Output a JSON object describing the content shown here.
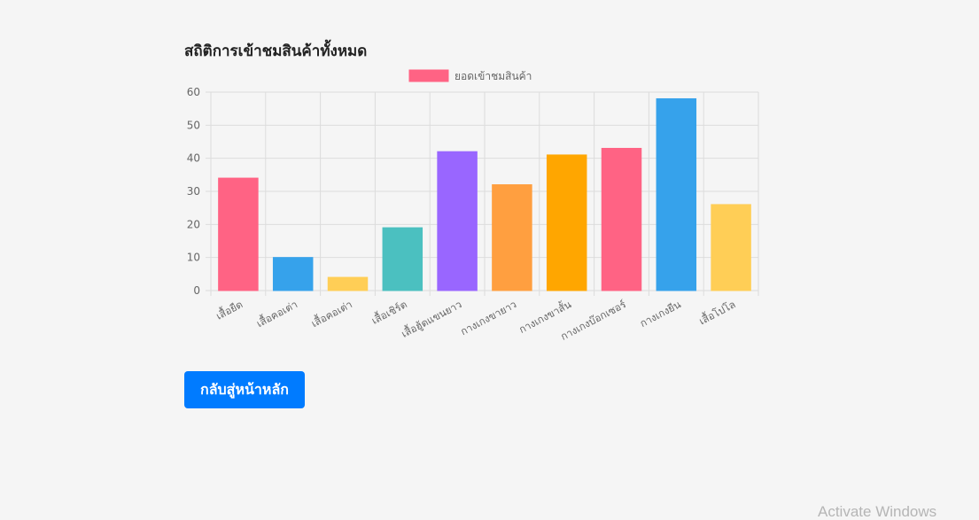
{
  "page": {
    "title": "สถิติการเข้าชมสินค้าทั้งหมด",
    "back_button": "กลับสู่หน้าหลัก",
    "watermark": "Activate Windows"
  },
  "chart_data": {
    "type": "bar",
    "categories": [
      "เสื้อยืด",
      "เสื้อคอเต่า",
      "เสื้อคอเต่า",
      "เสื้อเชิร์ต",
      "เสื้อฮู้ดแขนยาว",
      "กางเกงขายาว",
      "กางเกงขาสั้น",
      "กางเกงบ๊อกเซอร์",
      "กางเกงยีน",
      "เสื้อโปโล"
    ],
    "series": [
      {
        "name": "ยอดเข้าชมสินค้า",
        "values": [
          34,
          10,
          4,
          19,
          42,
          32,
          41,
          43,
          58,
          26
        ]
      }
    ],
    "colors": [
      "#ff6384",
      "#36a2eb",
      "#ffce56",
      "#4bc0c0",
      "#9966ff",
      "#ff9f40",
      "#ffa600",
      "#ff6384",
      "#36a2eb",
      "#ffce56"
    ],
    "legend_color": "#ff6384",
    "ylim": [
      0,
      60
    ],
    "yticks": [
      "0",
      "10",
      "20",
      "30",
      "40",
      "50",
      "60"
    ],
    "grid": true,
    "legend_position": "top"
  }
}
